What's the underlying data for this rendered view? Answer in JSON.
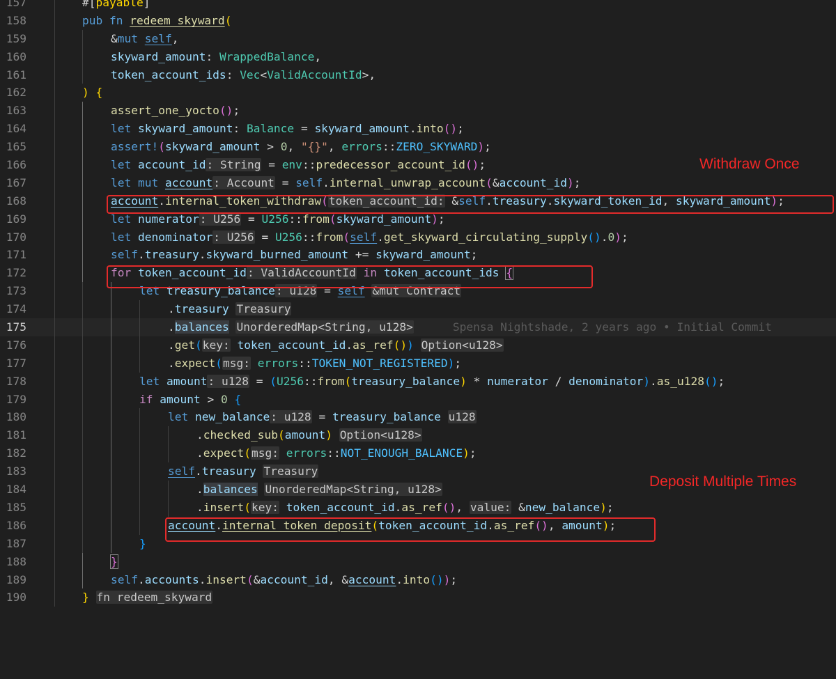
{
  "editor": {
    "line_numbers": [
      "157",
      "158",
      "159",
      "160",
      "161",
      "162",
      "163",
      "164",
      "165",
      "166",
      "167",
      "168",
      "169",
      "170",
      "171",
      "172",
      "173",
      "174",
      "175",
      "176",
      "177",
      "178",
      "179",
      "180",
      "181",
      "182",
      "183",
      "184",
      "185",
      "186",
      "187",
      "188",
      "189",
      "190"
    ],
    "current_line": "175",
    "blame_text": "Spensa Nightshade, 2 years ago • Initial Commit"
  },
  "annotations": {
    "withdraw_once": "Withdraw Once",
    "deposit_multiple": "Deposit Multiple Times",
    "box_color": "#e32b2b"
  },
  "theme": {
    "background": "#1f1f1f",
    "keyword": "#569cd6",
    "control": "#c586c0",
    "function": "#dcdcaa",
    "type": "#4ec9b0",
    "variable": "#9cdcfe",
    "string": "#ce9178",
    "number": "#b5cea8"
  }
}
